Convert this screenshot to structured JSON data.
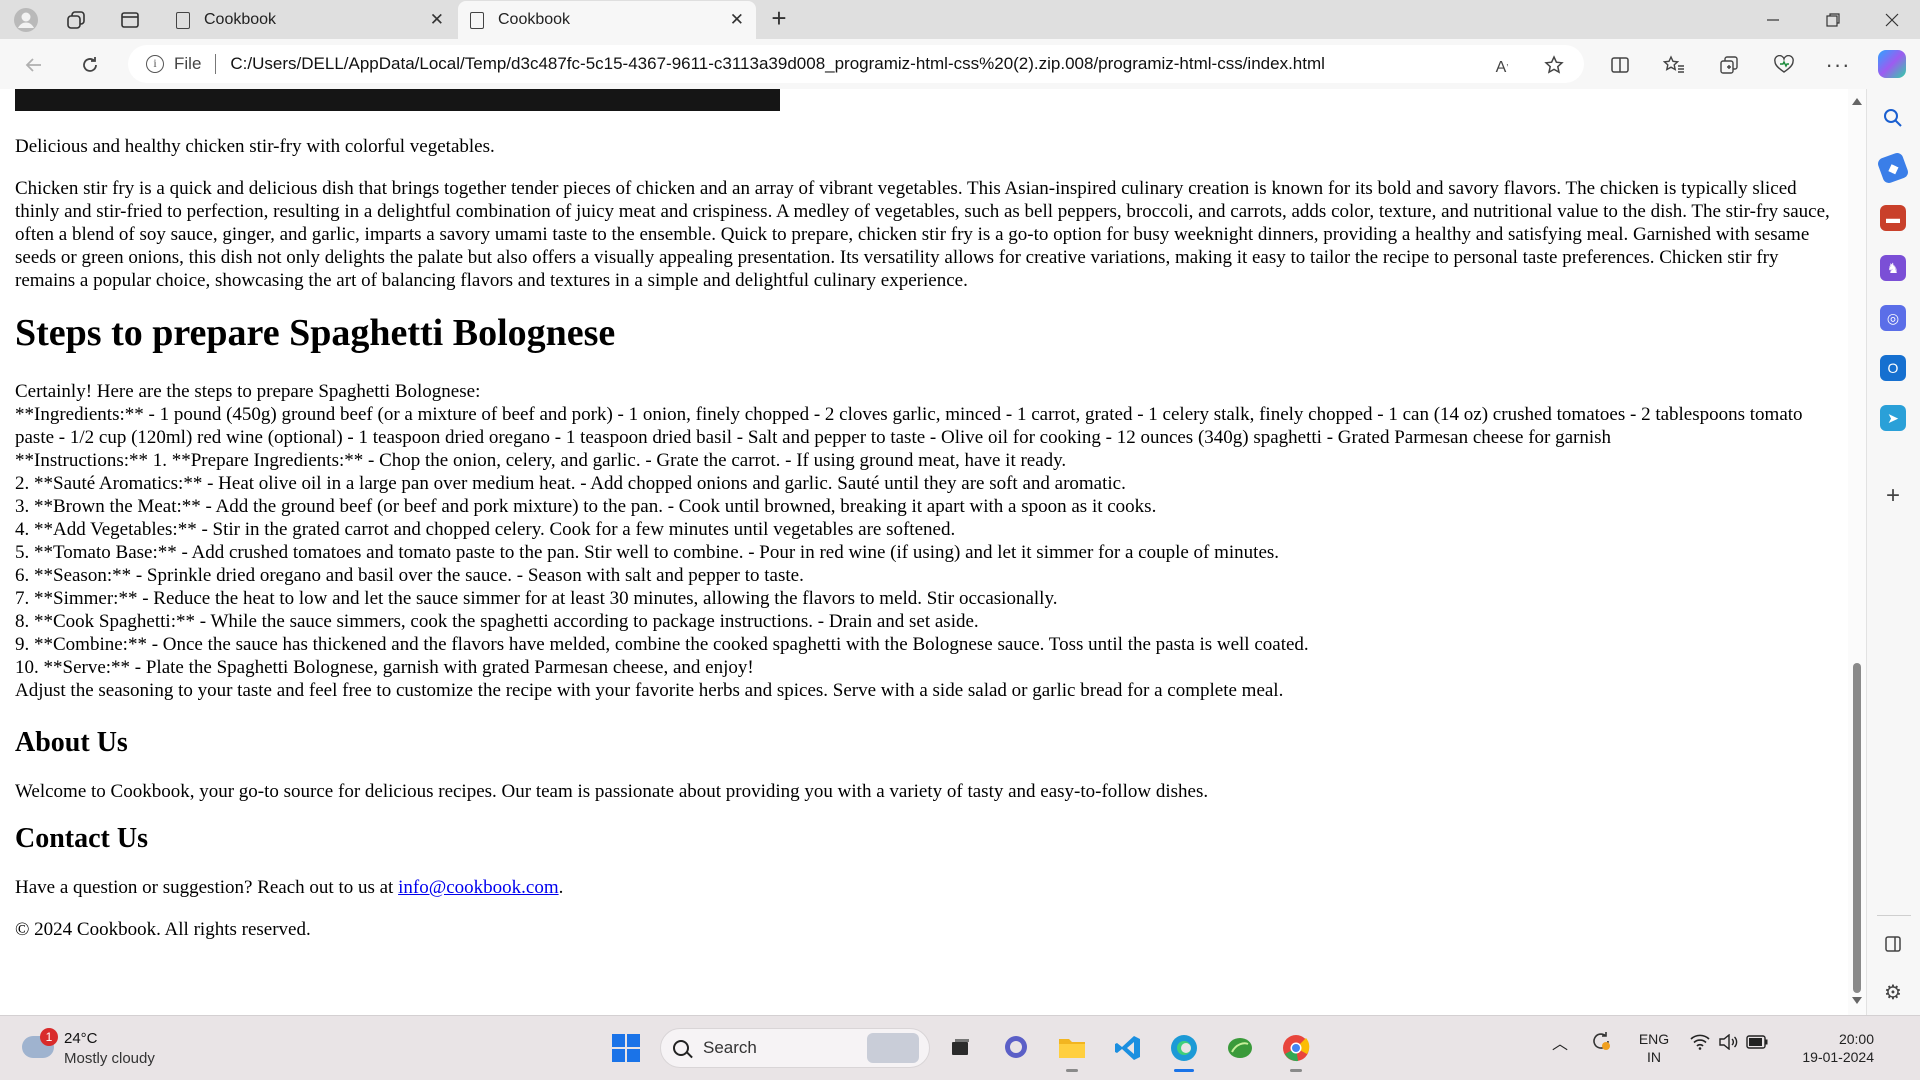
{
  "browser": {
    "tabs": [
      {
        "title": "Cookbook",
        "active": false
      },
      {
        "title": "Cookbook",
        "active": true
      }
    ],
    "address": {
      "scheme_label": "File",
      "url": "C:/Users/DELL/AppData/Local/Temp/d3c487fc-5c15-4367-9611-c3113a39d008_programiz-html-css%20(2).zip.008/programiz-html-css/index.html"
    }
  },
  "page": {
    "intro": "Delicious and healthy chicken stir-fry with colorful vegetables.",
    "description": "Chicken stir fry is a quick and delicious dish that brings together tender pieces of chicken and an array of vibrant vegetables. This Asian-inspired culinary creation is known for its bold and savory flavors. The chicken is typically sliced thinly and stir-fried to perfection, resulting in a delightful combination of juicy meat and crispiness. A medley of vegetables, such as bell peppers, broccoli, and carrots, adds color, texture, and nutritional value to the dish. The stir-fry sauce, often a blend of soy sauce, ginger, and garlic, imparts a savory umami taste to the ensemble. Quick to prepare, chicken stir fry is a go-to option for busy weeknight dinners, providing a healthy and satisfying meal. Garnished with sesame seeds or green onions, this dish not only delights the palate but also offers a visually appealing presentation. Its versatility allows for creative variations, making it easy to tailor the recipe to personal taste preferences. Chicken stir fry remains a popular choice, showcasing the art of balancing flavors and textures in a simple and delightful culinary experience.",
    "steps_heading": "Steps to prepare Spaghetti Bolognese",
    "steps": [
      "Certainly! Here are the steps to prepare Spaghetti Bolognese:",
      "**Ingredients:** - 1 pound (450g) ground beef (or a mixture of beef and pork) - 1 onion, finely chopped - 2 cloves garlic, minced - 1 carrot, grated - 1 celery stalk, finely chopped - 1 can (14 oz) crushed tomatoes - 2 tablespoons tomato paste - 1/2 cup (120ml) red wine (optional) - 1 teaspoon dried oregano - 1 teaspoon dried basil - Salt and pepper to taste - Olive oil for cooking - 12 ounces (340g) spaghetti - Grated Parmesan cheese for garnish",
      "**Instructions:** 1. **Prepare Ingredients:** - Chop the onion, celery, and garlic. - Grate the carrot. - If using ground meat, have it ready.",
      "2. **Sauté Aromatics:** - Heat olive oil in a large pan over medium heat. - Add chopped onions and garlic. Sauté until they are soft and aromatic.",
      "3. **Brown the Meat:** - Add the ground beef (or beef and pork mixture) to the pan. - Cook until browned, breaking it apart with a spoon as it cooks.",
      "4. **Add Vegetables:** - Stir in the grated carrot and chopped celery. Cook for a few minutes until vegetables are softened.",
      "5. **Tomato Base:** - Add crushed tomatoes and tomato paste to the pan. Stir well to combine. - Pour in red wine (if using) and let it simmer for a couple of minutes.",
      "6. **Season:** - Sprinkle dried oregano and basil over the sauce. - Season with salt and pepper to taste.",
      "7. **Simmer:** - Reduce the heat to low and let the sauce simmer for at least 30 minutes, allowing the flavors to meld. Stir occasionally.",
      "8. **Cook Spaghetti:** - While the sauce simmers, cook the spaghetti according to package instructions. - Drain and set aside.",
      "9. **Combine:** - Once the sauce has thickened and the flavors have melded, combine the cooked spaghetti with the Bolognese sauce. Toss until the pasta is well coated.",
      "10. **Serve:** - Plate the Spaghetti Bolognese, garnish with grated Parmesan cheese, and enjoy!",
      "Adjust the seasoning to your taste and feel free to customize the recipe with your favorite herbs and spices. Serve with a side salad or garlic bread for a complete meal."
    ],
    "about_heading": "About Us",
    "about_text": "Welcome to Cookbook, your go-to source for delicious recipes. Our team is passionate about providing you with a variety of tasty and easy-to-follow dishes.",
    "contact_heading": "Contact Us",
    "contact_prefix": "Have a question or suggestion? Reach out to us at ",
    "contact_email": "info@cookbook.com",
    "contact_suffix": ".",
    "footer": "© 2024 Cookbook. All rights reserved."
  },
  "taskbar": {
    "weather": {
      "badge": "1",
      "temp": "24°C",
      "condition": "Mostly cloudy"
    },
    "search_placeholder": "Search",
    "language": {
      "line1": "ENG",
      "line2": "IN"
    },
    "clock": {
      "time": "20:00",
      "date": "19-01-2024"
    }
  }
}
